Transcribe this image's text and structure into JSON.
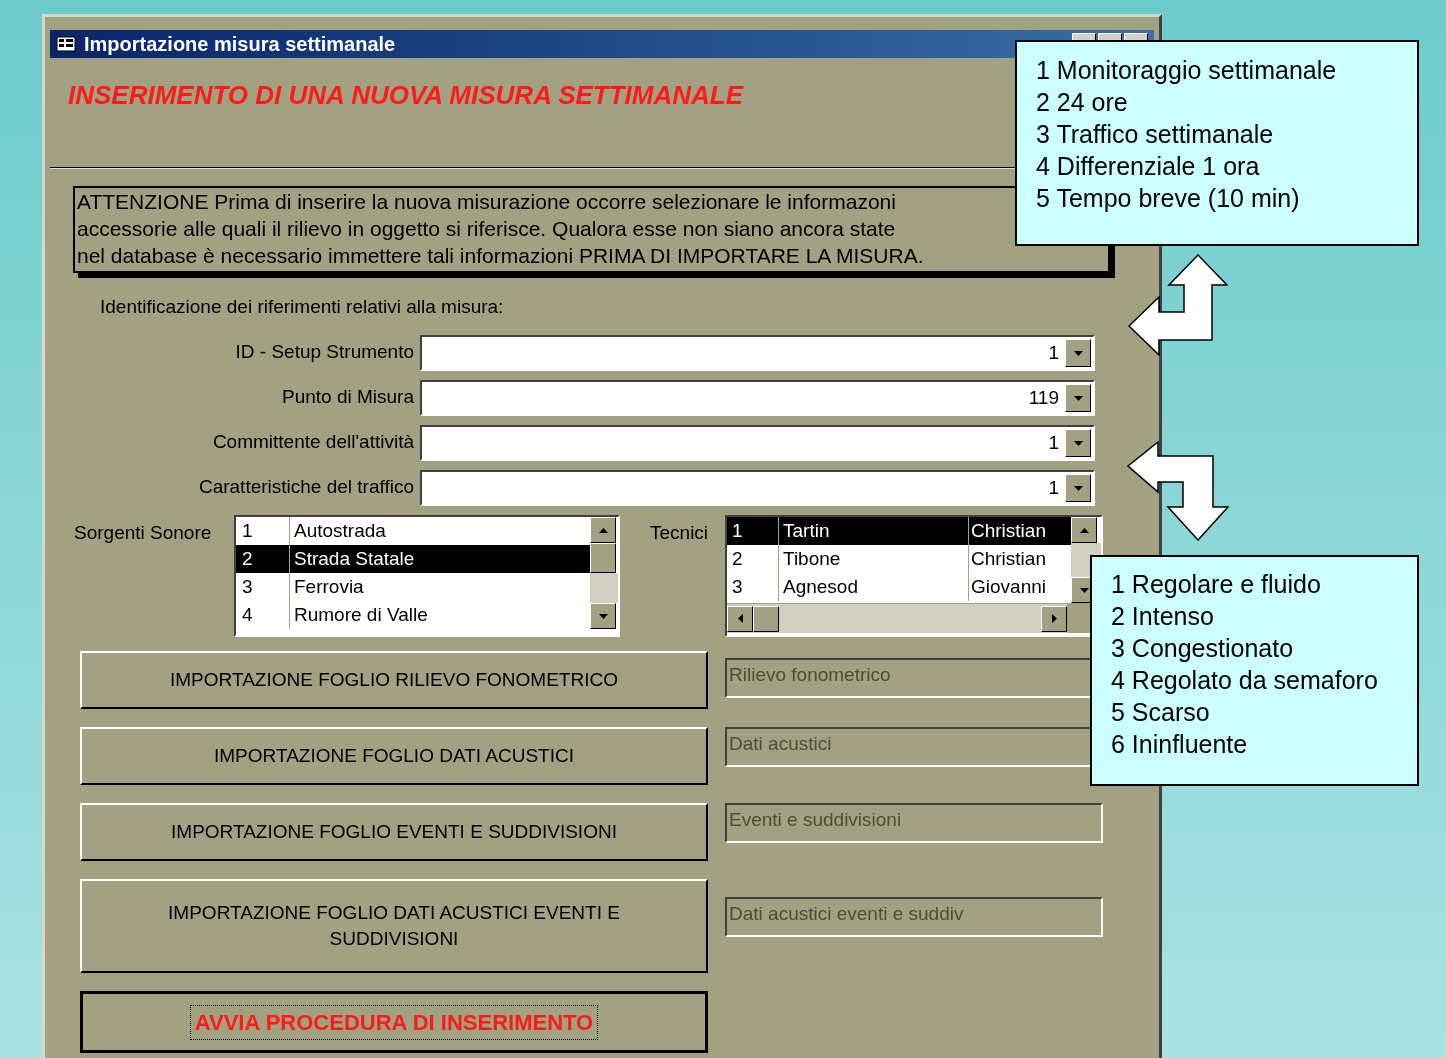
{
  "window": {
    "title": "Importazione misura settimanale"
  },
  "heading": "INSERIMENTO DI UNA NUOVA MISURA SETTIMANALE",
  "notice": [
    "ATTENZIONE  Prima di inserire la nuova misurazione occorre selezionare le informazoni",
    "accessorie alle quali il rilievo in oggetto si riferisce. Qualora esse non siano ancora state",
    "nel database  è necessario immettere tali informazioni PRIMA DI IMPORTARE LA MISURA."
  ],
  "section_label": "Identificazione dei riferimenti relativi alla misura:",
  "combos": [
    {
      "label": "ID - Setup Strumento",
      "value": "1"
    },
    {
      "label": "Punto di Misura",
      "value": "119"
    },
    {
      "label": "Committente dell'attività",
      "value": "1"
    },
    {
      "label": "Caratteristiche del traffico",
      "value": "1"
    }
  ],
  "sources": {
    "label": "Sorgenti Sonore",
    "rows": [
      {
        "cells": [
          "1",
          "Autostrada"
        ],
        "selected": false
      },
      {
        "cells": [
          "2",
          "Strada Statale"
        ],
        "selected": true
      },
      {
        "cells": [
          "3",
          "Ferrovia"
        ],
        "selected": false
      },
      {
        "cells": [
          "4",
          "Rumore di Valle"
        ],
        "selected": false
      }
    ]
  },
  "technicians": {
    "label": "Tecnici",
    "rows": [
      {
        "cells": [
          "1",
          "Tartin",
          "Christian"
        ],
        "selected": true
      },
      {
        "cells": [
          "2",
          "Tibone",
          "Christian"
        ],
        "selected": false
      },
      {
        "cells": [
          "3",
          "Agnesod",
          "Giovanni"
        ],
        "selected": false
      }
    ]
  },
  "import_buttons": [
    {
      "label": "IMPORTAZIONE FOGLIO RILIEVO FONOMETRICO",
      "status": {
        "value": "Rilievo fonometrico",
        "disabled": true
      }
    },
    {
      "label": "IMPORTAZIONE FOGLIO DATI ACUSTICI",
      "status": {
        "value": "Dati acustici",
        "disabled": true
      }
    },
    {
      "label": "IMPORTAZIONE FOGLIO EVENTI E SUDDIVISIONI",
      "status": {
        "value": "Eventi e suddivisioni",
        "disabled": true
      }
    },
    {
      "label": "IMPORTAZIONE FOGLIO DATI ACUSTICI EVENTI E SUDDIVISIONI",
      "status": {
        "value": "Dati acustici eventi e suddiv",
        "disabled": true
      }
    }
  ],
  "start_button": {
    "label": "AVVIA PROCEDURA DI INSERIMENTO",
    "focused": true
  },
  "callouts": [
    {
      "lines": [
        "1 Monitoraggio settimanale",
        "2 24 ore",
        "3 Traffico settimanale",
        "4 Differenziale 1 ora",
        "5 Tempo breve (10 min)"
      ]
    },
    {
      "lines": [
        "1 Regolare e fluido",
        "2 Intenso",
        "3 Congestionato",
        "4 Regolato da semaforo",
        "5 Scarso",
        "6 Ininfluente"
      ]
    }
  ]
}
